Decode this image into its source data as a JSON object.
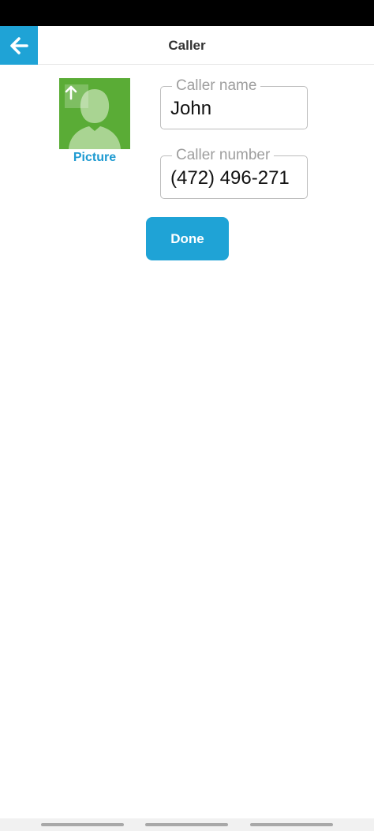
{
  "header": {
    "title": "Caller",
    "back_icon": "arrow-left-icon"
  },
  "picture": {
    "label": "Picture",
    "upload_icon": "arrow-up-icon",
    "placeholder_icon": "person-silhouette-icon",
    "background_color": "#5aac36"
  },
  "fields": {
    "name": {
      "label": "Caller name",
      "value": "John"
    },
    "number": {
      "label": "Caller number",
      "value": "(472) 496-271"
    }
  },
  "actions": {
    "done_label": "Done"
  },
  "colors": {
    "accent": "#1fa3d6",
    "link": "#1e9ad1"
  }
}
